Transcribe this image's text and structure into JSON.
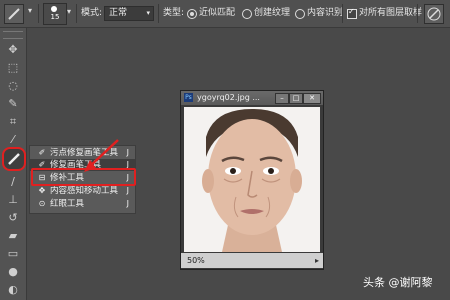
{
  "options_bar": {
    "brush_size": "15",
    "mode_label": "模式:",
    "mode_value": "正常",
    "type_label": "类型:",
    "type_options": [
      {
        "label": "近似匹配",
        "selected": true
      },
      {
        "label": "创建纹理",
        "selected": false
      },
      {
        "label": "内容识别",
        "selected": false
      }
    ],
    "sample_all_layers_label": "对所有图层取样",
    "sample_all_layers_checked": true
  },
  "tool_flyout": {
    "items": [
      {
        "icon": "spot-healing-brush-icon",
        "label": "污点修复画笔工具",
        "key": "J",
        "selected": false
      },
      {
        "icon": "healing-brush-icon",
        "label": "修复画笔工具",
        "key": "J",
        "selected": true
      },
      {
        "icon": "patch-tool-icon",
        "label": "修补工具",
        "key": "J",
        "selected": false
      },
      {
        "icon": "content-aware-move-icon",
        "label": "内容感知移动工具",
        "key": "J",
        "selected": false
      },
      {
        "icon": "red-eye-icon",
        "label": "红眼工具",
        "key": "J",
        "selected": false
      }
    ]
  },
  "document": {
    "title": "ygoyrq02.jpg ...",
    "zoom": "50%"
  },
  "colors": {
    "highlight_red": "#e02020",
    "panel_bg": "#494949"
  },
  "watermark": "头条 @谢阿黎"
}
